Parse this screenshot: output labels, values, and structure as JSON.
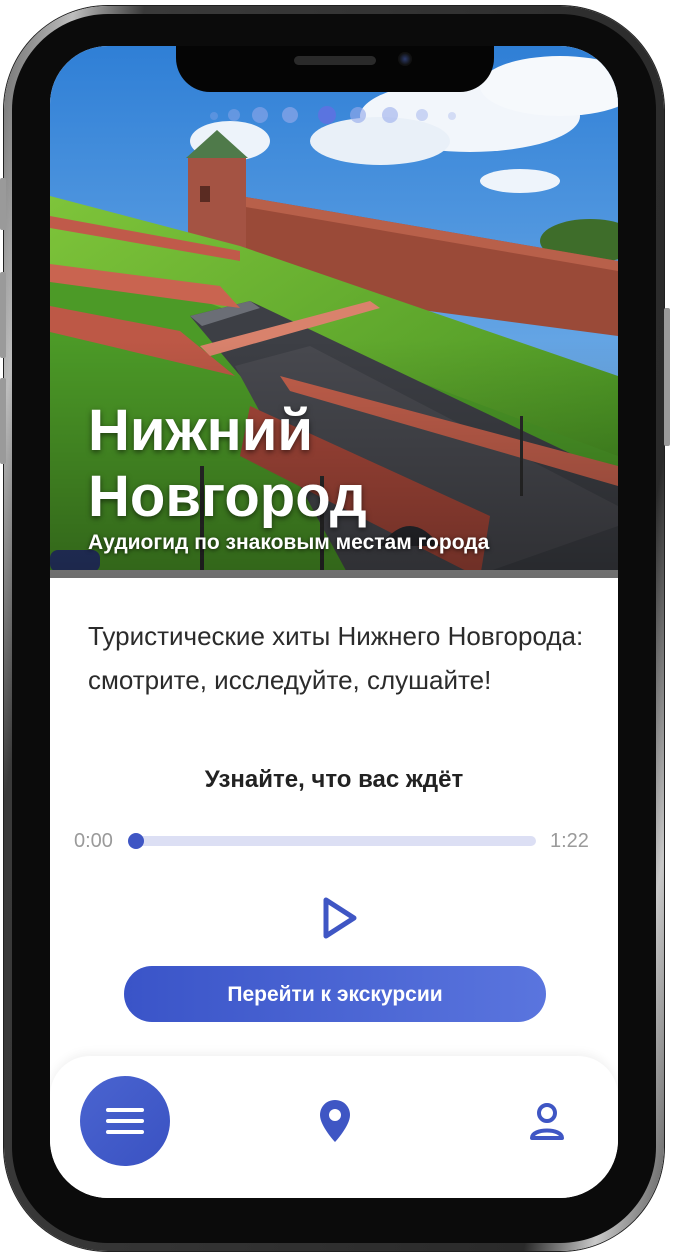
{
  "hero": {
    "title_line1": "Нижний",
    "title_line2": "Новгород",
    "subtitle": "Аудиогид по знаковым местам города",
    "carousel_active_index": 3,
    "carousel_count": 8
  },
  "content": {
    "description": "Туристические хиты Нижнего Новгорода: смотрите, исследуйте, слушайте!",
    "audio_heading": "Узнайте, что вас ждёт"
  },
  "player": {
    "current_time": "0:00",
    "duration": "1:22",
    "progress": 0
  },
  "actions": {
    "start_tour_label": "Перейти к экскурсии"
  },
  "nav": {
    "items": [
      "menu-icon",
      "map-pin-icon",
      "profile-icon"
    ]
  },
  "colors": {
    "accent": "#3f56c4",
    "track": "#dcdff4"
  }
}
